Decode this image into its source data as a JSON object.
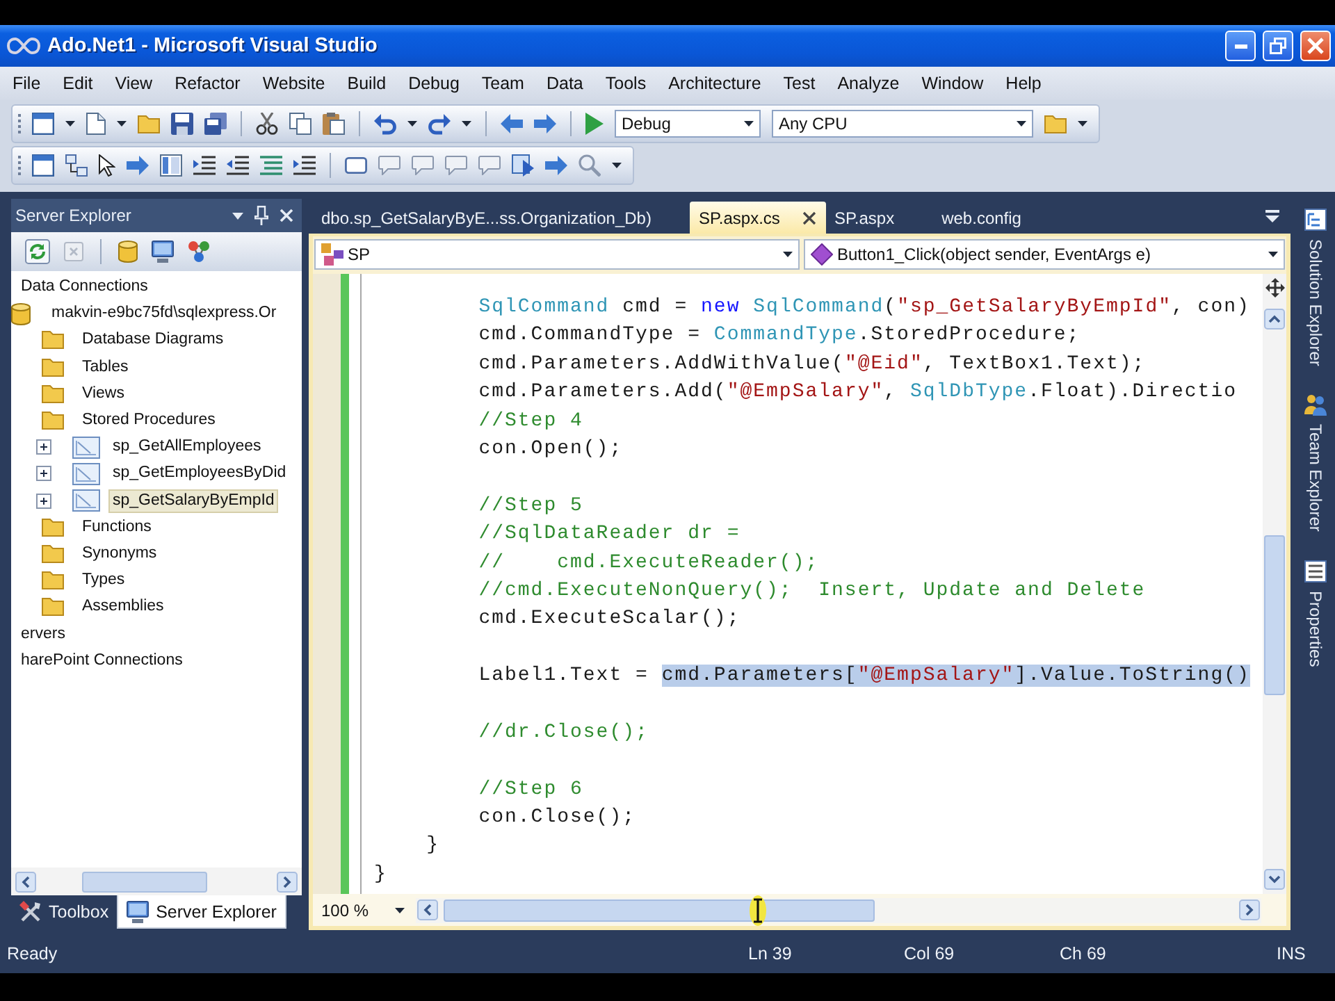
{
  "window": {
    "title": "Ado.Net1 - Microsoft Visual Studio"
  },
  "menu": [
    "File",
    "Edit",
    "View",
    "Refactor",
    "Website",
    "Build",
    "Debug",
    "Team",
    "Data",
    "Tools",
    "Architecture",
    "Test",
    "Analyze",
    "Window",
    "Help"
  ],
  "toolbar": {
    "configuration": "Debug",
    "platform": "Any CPU"
  },
  "server_explorer": {
    "title": "Server Explorer",
    "tree": [
      {
        "label": "Data Connections",
        "selected": false,
        "children": [
          {
            "label": "makvin-e9bc75fd\\sqlexpress.Or",
            "kind": "connection",
            "selected": false,
            "children": [
              {
                "label": "Database Diagrams",
                "kind": "folder",
                "selected": false
              },
              {
                "label": "Tables",
                "kind": "folder",
                "selected": false
              },
              {
                "label": "Views",
                "kind": "folder",
                "selected": false
              },
              {
                "label": "Stored Procedures",
                "kind": "folder",
                "selected": false,
                "children": [
                  {
                    "label": "sp_GetAllEmployees",
                    "kind": "procedure",
                    "selected": false,
                    "expanded": false
                  },
                  {
                    "label": "sp_GetEmployeesByDid",
                    "kind": "procedure",
                    "selected": false,
                    "expanded": false
                  },
                  {
                    "label": "sp_GetSalaryByEmpId",
                    "kind": "procedure",
                    "selected": true,
                    "expanded": false
                  }
                ]
              },
              {
                "label": "Functions",
                "kind": "folder",
                "selected": false
              },
              {
                "label": "Synonyms",
                "kind": "folder",
                "selected": false
              },
              {
                "label": "Types",
                "kind": "folder",
                "selected": false
              },
              {
                "label": "Assemblies",
                "kind": "folder",
                "selected": false
              }
            ]
          }
        ]
      },
      {
        "label": "ervers",
        "selected": false
      },
      {
        "label": "harePoint Connections",
        "selected": false
      }
    ],
    "tabs": [
      {
        "label": "Toolbox",
        "selected": false
      },
      {
        "label": "Server Explorer",
        "selected": true
      }
    ]
  },
  "editor": {
    "tabs": [
      {
        "label": "dbo.sp_GetSalaryByE...ss.Organization_Db)",
        "selected": false
      },
      {
        "label": "SP.aspx.cs",
        "selected": true
      },
      {
        "label": "SP.aspx",
        "selected": false
      },
      {
        "label": "web.config",
        "selected": false
      }
    ],
    "type_dropdown": "SP",
    "member_dropdown": "Button1_Click(object sender, EventArgs e)",
    "code": [
      {
        "kind": "block",
        "closing": "}",
        "children": [
          {
            "kind": "block",
            "closing": "}",
            "children": [
              {
                "kind": "line",
                "tokens": [
                  {
                    "kind": "type",
                    "text": "SqlCommand"
                  },
                  {
                    "kind": "plain",
                    "text": " cmd = "
                  },
                  {
                    "kind": "keyword",
                    "text": "new"
                  },
                  {
                    "kind": "type",
                    "text": " SqlCommand"
                  },
                  {
                    "kind": "plain",
                    "text": "("
                  },
                  {
                    "kind": "string",
                    "text": "\"sp_GetSalaryByEmpId\""
                  },
                  {
                    "kind": "plain",
                    "text": ", con)"
                  }
                ]
              },
              {
                "kind": "line",
                "tokens": [
                  {
                    "kind": "plain",
                    "text": "cmd.CommandType = "
                  },
                  {
                    "kind": "type",
                    "text": "CommandType"
                  },
                  {
                    "kind": "plain",
                    "text": ".StoredProcedure;"
                  }
                ]
              },
              {
                "kind": "line",
                "tokens": [
                  {
                    "kind": "plain",
                    "text": "cmd.Parameters.AddWithValue("
                  },
                  {
                    "kind": "string",
                    "text": "\"@Eid\""
                  },
                  {
                    "kind": "plain",
                    "text": ", TextBox1.Text);"
                  }
                ]
              },
              {
                "kind": "line",
                "tokens": [
                  {
                    "kind": "plain",
                    "text": "cmd.Parameters.Add("
                  },
                  {
                    "kind": "string",
                    "text": "\"@EmpSalary\""
                  },
                  {
                    "kind": "plain",
                    "text": ", "
                  },
                  {
                    "kind": "type",
                    "text": "SqlDbType"
                  },
                  {
                    "kind": "plain",
                    "text": ".Float).Directio"
                  }
                ]
              },
              {
                "kind": "line",
                "tokens": [
                  {
                    "kind": "comment",
                    "text": "//Step 4"
                  }
                ]
              },
              {
                "kind": "line",
                "tokens": [
                  {
                    "kind": "plain",
                    "text": "con.Open();"
                  }
                ]
              },
              {
                "kind": "blank"
              },
              {
                "kind": "line",
                "tokens": [
                  {
                    "kind": "comment",
                    "text": "//Step 5"
                  }
                ]
              },
              {
                "kind": "line",
                "tokens": [
                  {
                    "kind": "comment",
                    "text": "//SqlDataReader dr ="
                  }
                ]
              },
              {
                "kind": "line",
                "tokens": [
                  {
                    "kind": "comment",
                    "text": "//    cmd.ExecuteReader();"
                  }
                ]
              },
              {
                "kind": "line",
                "tokens": [
                  {
                    "kind": "comment",
                    "text": "//cmd.ExecuteNonQuery();  Insert, Update and Delete"
                  }
                ]
              },
              {
                "kind": "line",
                "tokens": [
                  {
                    "kind": "plain",
                    "text": "cmd.ExecuteScalar();"
                  }
                ]
              },
              {
                "kind": "blank"
              },
              {
                "kind": "line",
                "tokens": [
                  {
                    "kind": "plain",
                    "text": "Label1.Text = "
                  }
                ],
                "selection": [
                  {
                    "kind": "plain",
                    "text": "cmd.Parameters["
                  },
                  {
                    "kind": "string",
                    "text": "\"@EmpSalary\""
                  },
                  {
                    "kind": "plain",
                    "text": "].Value.ToString()"
                  }
                ]
              },
              {
                "kind": "blank"
              },
              {
                "kind": "line",
                "tokens": [
                  {
                    "kind": "comment",
                    "text": "//dr.Close();"
                  }
                ]
              },
              {
                "kind": "blank"
              },
              {
                "kind": "line",
                "tokens": [
                  {
                    "kind": "comment",
                    "text": "//Step 6"
                  }
                ]
              },
              {
                "kind": "line",
                "tokens": [
                  {
                    "kind": "plain",
                    "text": "con.Close();"
                  }
                ]
              }
            ]
          }
        ]
      }
    ],
    "zoom": "100 %"
  },
  "side_tabs": [
    "Solution Explorer",
    "Team Explorer",
    "Properties"
  ],
  "status_bar": {
    "message": "Ready",
    "line": "Ln 39",
    "column": "Col 69",
    "character": "Ch 69",
    "mode": "INS"
  }
}
